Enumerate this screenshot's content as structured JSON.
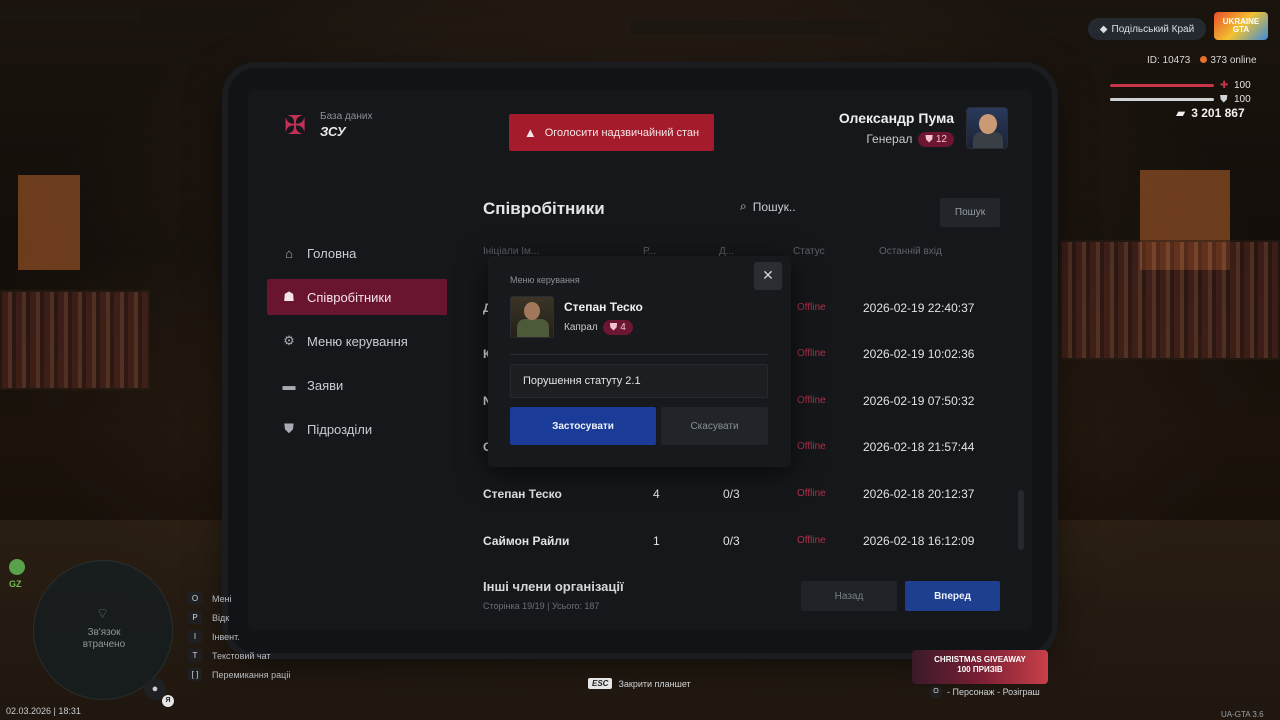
{
  "hud": {
    "server_name": "Подільський Край",
    "logo_text": "UKRAINE GTA",
    "id_label": "ID: 10473",
    "online_label": "373 online",
    "health_value": "100",
    "armor_value": "100",
    "money": "3 201 867",
    "colors": {
      "health": "#c8344a",
      "armor": "#d0d2d5"
    }
  },
  "header": {
    "brand_sub": "База даних",
    "brand_title": "ЗСУ",
    "emergency_label": "Оголосити надзвичайний стан",
    "user_name": "Олександр Пума",
    "user_rank": "Генерал",
    "user_rank_level": "12"
  },
  "sidebar": {
    "items": [
      {
        "label": "Головна",
        "icon": "home-icon"
      },
      {
        "label": "Співробітники",
        "icon": "users-icon"
      },
      {
        "label": "Меню керування",
        "icon": "gear-icon"
      },
      {
        "label": "Заяви",
        "icon": "folder-icon"
      },
      {
        "label": "Підрозділи",
        "icon": "shield-icon"
      }
    ],
    "active_index": 1
  },
  "main": {
    "title": "Співробітники",
    "search_placeholder": "Пошук..",
    "search_button": "Пошук",
    "columns": [
      "Ініціали",
      "Ранг",
      "Догани",
      "Статус",
      "Останній вхід"
    ],
    "visible_header": {
      "name": "Ініціали Ім...",
      "rank": "Р...",
      "warns": "Д...",
      "status": "Статус",
      "last": "Останній вхід"
    },
    "rows": [
      {
        "name": "Д",
        "rank": "",
        "warns": "",
        "status": "Offline",
        "last": "2026-02-19 22:40:37"
      },
      {
        "name": "К",
        "rank": "",
        "warns": "",
        "status": "Offline",
        "last": "2026-02-19 10:02:36"
      },
      {
        "name": "N",
        "rank": "",
        "warns": "",
        "status": "Offline",
        "last": "2026-02-19 07:50:32"
      },
      {
        "name": "С",
        "rank": "",
        "warns": "",
        "status": "Offline",
        "last": "2026-02-18 21:57:44"
      },
      {
        "name": "Степан Теско",
        "rank": "4",
        "warns": "0/3",
        "status": "Offline",
        "last": "2026-02-18 20:12:37"
      },
      {
        "name": "Саймон Райли",
        "rank": "1",
        "warns": "0/3",
        "status": "Offline",
        "last": "2026-02-18 16:12:09"
      }
    ],
    "others_label": "Інші члени організації",
    "page_info": "Сторінка 19/19 | Усього: 187",
    "back_button": "Назад",
    "next_button": "Вперед"
  },
  "modal": {
    "title": "Меню керування",
    "close_glyph": "✕",
    "employee_name": "Степан Теско",
    "employee_rank": "Капрал",
    "employee_rank_level": "4",
    "reason_value": "Порушення статуту 2.1",
    "apply_label": "Застосувати",
    "cancel_label": "Скасувати"
  },
  "bottom_hud": {
    "gz_label": "GZ",
    "minimap_text_1": "Зв'язок",
    "minimap_text_2": "втрачено",
    "mic_badge": "Я",
    "date": "02.03.2026 | 18:31",
    "keybinds": [
      {
        "key": "O",
        "label": "Мені"
      },
      {
        "key": "P",
        "label": "Відк"
      },
      {
        "key": "I",
        "label": "Інвент."
      },
      {
        "key": "T",
        "label": "Текстовий чат"
      },
      {
        "key": "[ ]",
        "label": "Перемикання раціі"
      }
    ],
    "esc_key": "ESC",
    "esc_label": "Закрити планшет",
    "giveaway_title": "CHRISTMAS GIVEAWAY",
    "giveaway_sub": "100 ПРИЗІВ",
    "giveaway_key": "O",
    "giveaway_label": "- Персонаж - Розіграш",
    "version": "UA-GTA 3.6"
  }
}
